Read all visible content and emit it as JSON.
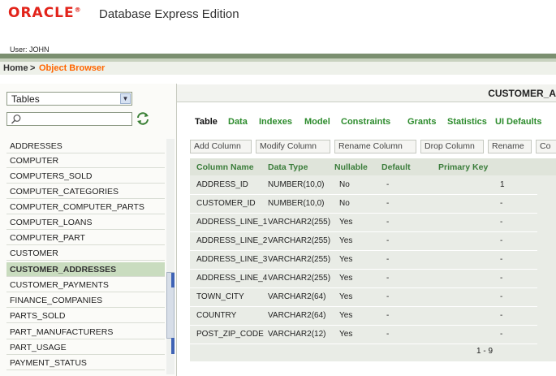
{
  "header": {
    "brand": "ORACLE",
    "product": "Database Express Edition",
    "user_label": "User: JOHN"
  },
  "breadcrumb": {
    "home": "Home",
    "separator": ">",
    "current": "Object Browser"
  },
  "left_panel": {
    "object_type": "Tables",
    "search_value": "",
    "tables": [
      "ADDRESSES",
      "COMPUTER",
      "COMPUTERS_SOLD",
      "COMPUTER_CATEGORIES",
      "COMPUTER_COMPUTER_PARTS",
      "COMPUTER_LOANS",
      "COMPUTER_PART",
      "CUSTOMER",
      "CUSTOMER_ADDRESSES",
      "CUSTOMER_PAYMENTS",
      "FINANCE_COMPANIES",
      "PARTS_SOLD",
      "PART_MANUFACTURERS",
      "PART_USAGE",
      "PAYMENT_STATUS"
    ],
    "selected_table": "CUSTOMER_ADDRESSES"
  },
  "right_panel": {
    "title": "CUSTOMER_A",
    "tabs": [
      "Table",
      "Data",
      "Indexes",
      "Model",
      "Constraints",
      "Grants",
      "Statistics",
      "UI Defaults"
    ],
    "active_tab": "Table",
    "actions": [
      "Add Column",
      "Modify Column",
      "Rename Column",
      "Drop Column",
      "Rename",
      "Co"
    ],
    "columns_header": [
      "Column Name",
      "Data Type",
      "Nullable",
      "Default",
      "Primary Key"
    ],
    "columns": [
      [
        "ADDRESS_ID",
        "NUMBER(10,0)",
        "No",
        "-",
        "1"
      ],
      [
        "CUSTOMER_ID",
        "NUMBER(10,0)",
        "No",
        "-",
        "-"
      ],
      [
        "ADDRESS_LINE_1",
        "VARCHAR2(255)",
        "Yes",
        "-",
        "-"
      ],
      [
        "ADDRESS_LINE_2",
        "VARCHAR2(255)",
        "Yes",
        "-",
        "-"
      ],
      [
        "ADDRESS_LINE_3",
        "VARCHAR2(255)",
        "Yes",
        "-",
        "-"
      ],
      [
        "ADDRESS_LINE_4",
        "VARCHAR2(255)",
        "Yes",
        "-",
        "-"
      ],
      [
        "TOWN_CITY",
        "VARCHAR2(64)",
        "Yes",
        "-",
        "-"
      ],
      [
        "COUNTRY",
        "VARCHAR2(64)",
        "Yes",
        "-",
        "-"
      ],
      [
        "POST_ZIP_CODE",
        "VARCHAR2(12)",
        "Yes",
        "-",
        "-"
      ]
    ],
    "pagination": "1 - 9"
  },
  "colors": {
    "brand_red": "#e2231a",
    "breadcrumb_current": "#ff6600",
    "tab_link": "#2c8b2c",
    "selected_row": "#c9dcbf"
  }
}
